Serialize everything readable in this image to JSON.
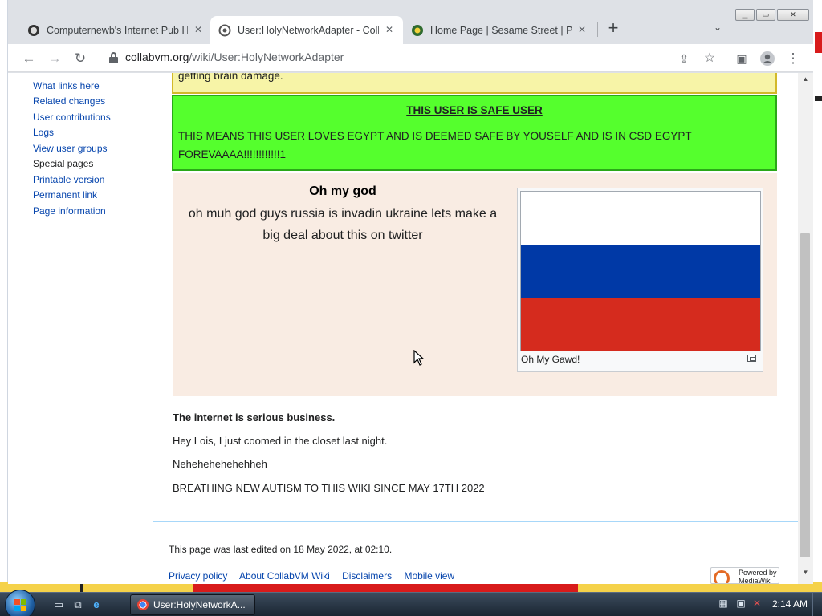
{
  "browser": {
    "tabs": [
      {
        "title": "Computernewb's Internet Pub Ho",
        "icon": "computernewb-favicon-icon"
      },
      {
        "title": "User:HolyNetworkAdapter - Colla",
        "icon": "collabvm-favicon-icon",
        "active": true
      },
      {
        "title": "Home Page | Sesame Street | PBS",
        "icon": "pbs-favicon-icon"
      }
    ],
    "url_domain": "collabvm.org",
    "url_path": "/wiki/User:HolyNetworkAdapter"
  },
  "sidebar": {
    "links": [
      "What links here",
      "Related changes",
      "User contributions",
      "Logs",
      "View user groups",
      "Special pages",
      "Printable version",
      "Permanent link",
      "Page information"
    ]
  },
  "page": {
    "yellow_box_text": "getting brain damage.",
    "green_box": {
      "title": "THIS USER IS SAFE USER",
      "text": "THIS MEANS THIS USER LOVES EGYPT AND IS DEEMED SAFE BY YOUSELF AND IS IN CSD EGYPT FOREVAAAA!!!!!!!!!!!!1"
    },
    "peach_box": {
      "title": "Oh my god",
      "text": "oh muh god guys russia is invadin ukraine lets make a big deal about this on twitter",
      "image_caption": "Oh My Gawd!"
    },
    "body_bold": "The internet is serious business.",
    "body_lines": [
      "Hey Lois, I just coomed in the closet last night.",
      "Nehehehehehehheh",
      "BREATHING NEW AUTISM TO THIS WIKI SINCE MAY 17TH 2022"
    ],
    "footer": {
      "last_edited": "This page was last edited on 18 May 2022, at 02:10.",
      "links": [
        "Privacy policy",
        "About CollabVM Wiki",
        "Disclaimers",
        "Mobile view"
      ],
      "powered_by": "Powered by MediaWiki"
    }
  },
  "taskbar": {
    "task_label": "User:HolyNetworkA...",
    "clock": "2:14 AM"
  },
  "colors": {
    "link": "#0645ad",
    "green_box_bg": "#55ff2d",
    "yellow_box_bg": "#f7f4a7",
    "peach_box_bg": "#f9ece3"
  }
}
